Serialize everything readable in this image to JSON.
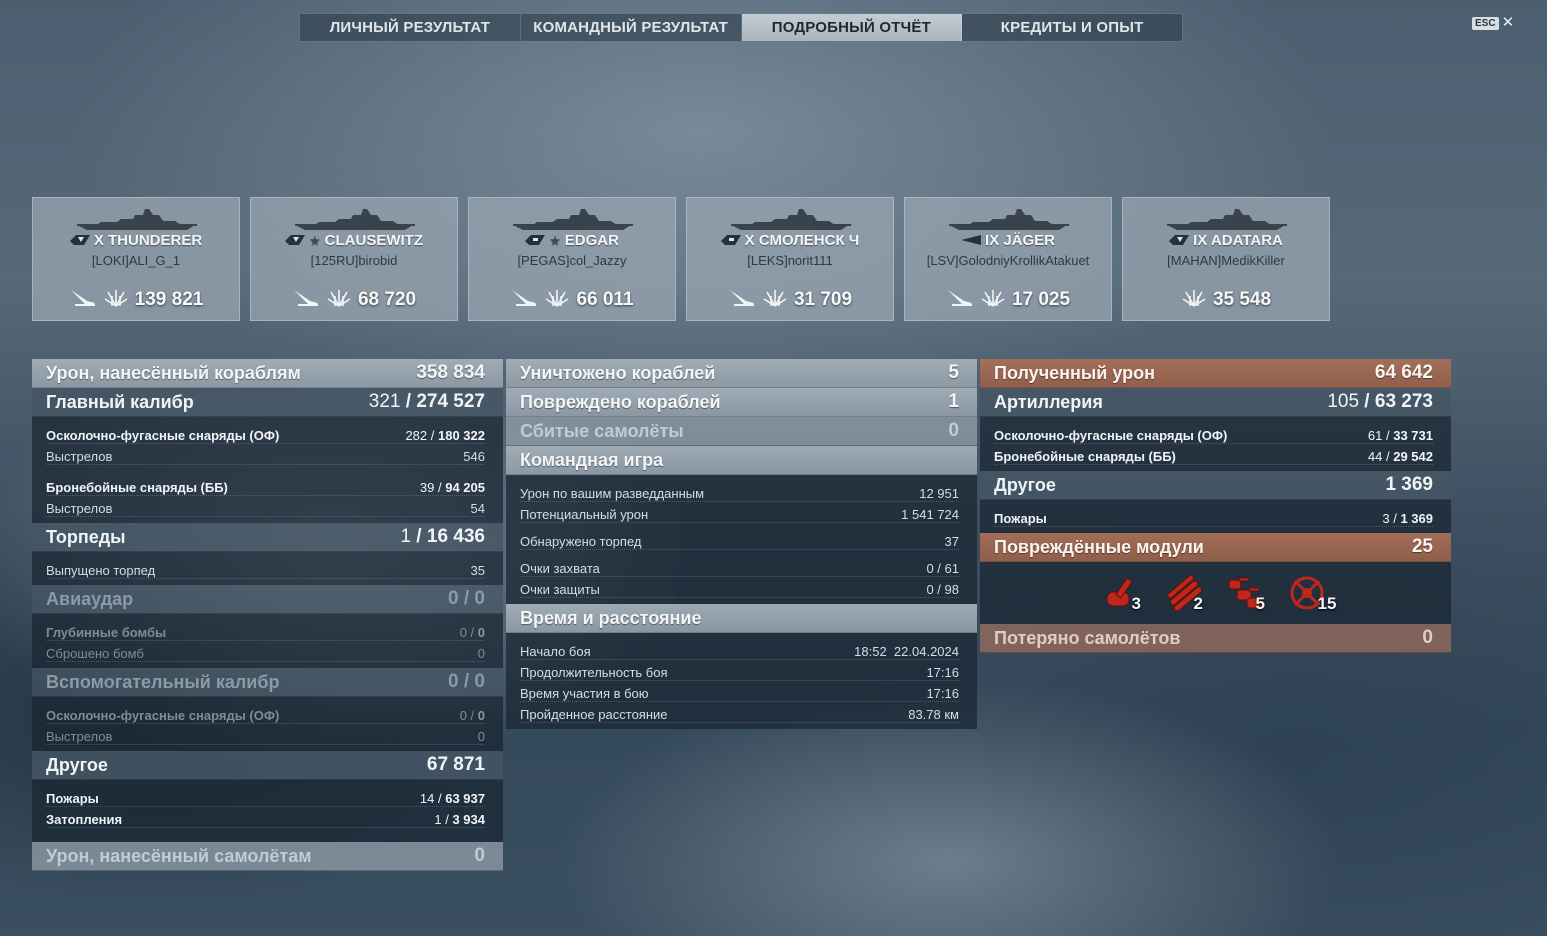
{
  "tabs": [
    "ЛИЧНЫЙ РЕЗУЛЬТАТ",
    "КОМАНДНЫЙ РЕЗУЛЬТАТ",
    "ПОДРОБНЫЙ ОТЧЁТ",
    "КРЕДИТЫ И ОПЫТ"
  ],
  "active_tab": "ПОДРОБНЫЙ ОТЧЁТ",
  "esc": {
    "key": "ESC",
    "close": "✕"
  },
  "ships": [
    {
      "name": "X THUNDERER",
      "player": "[LOKI]ALI_G_1",
      "damage": "139 821",
      "type_icon": "battleship-icon",
      "premium": false,
      "torpedo_icon": true
    },
    {
      "name": "CLAUSEWITZ",
      "player": "[125RU]birobid",
      "damage": "68 720",
      "type_icon": "battleship-icon",
      "premium": true,
      "torpedo_icon": true
    },
    {
      "name": "EDGAR",
      "player": "[PEGAS]col_Jazzy",
      "damage": "66 011",
      "type_icon": "cruiser-icon",
      "premium": true,
      "torpedo_icon": true
    },
    {
      "name": "X СМОЛЕНСК Ч",
      "player": "[LEKS]norit111",
      "damage": "31 709",
      "type_icon": "cruiser-icon",
      "premium": false,
      "torpedo_icon": true
    },
    {
      "name": "IX JÄGER",
      "player": "[LSV]GolodniyKrollikAtakuet",
      "damage": "17 025",
      "type_icon": "destroyer-icon",
      "premium": false,
      "torpedo_icon": true
    },
    {
      "name": "IX ADATARA",
      "player": "[MAHAN]MedikKiller",
      "damage": "35 548",
      "type_icon": "battleship-icon",
      "premium": false,
      "torpedo_icon": false
    }
  ],
  "left": {
    "total": {
      "label": "Урон, нанесённый кораблям",
      "value": "358 834"
    },
    "main": {
      "label": "Главный калибр",
      "hits": "321",
      "value": "274 527",
      "he_label": "Осколочно-фугасные снаряды (ОФ)",
      "he_hits": "282",
      "he_value": "180 322",
      "he_shots_label": "Выстрелов",
      "he_shots": "546",
      "ap_label": "Бронебойные снаряды (ББ)",
      "ap_hits": "39",
      "ap_value": "94 205",
      "ap_shots_label": "Выстрелов",
      "ap_shots": "54"
    },
    "torp": {
      "label": "Торпеды",
      "hits": "1",
      "value": "16 436",
      "launched_label": "Выпущено торпед",
      "launched": "35"
    },
    "air": {
      "label": "Авиаудар",
      "hits": "0",
      "value": "0",
      "dc_label": "Глубинные бомбы",
      "dc_hits": "0",
      "dc_value": "0",
      "bombs_label": "Сброшено бомб",
      "bombs": "0"
    },
    "sec": {
      "label": "Вспомогательный калибр",
      "hits": "0",
      "value": "0",
      "he_label": "Осколочно-фугасные снаряды (ОФ)",
      "he_hits": "0",
      "he_value": "0",
      "shots_label": "Выстрелов",
      "shots": "0"
    },
    "other": {
      "label": "Другое",
      "value": "67 871",
      "fires_label": "Пожары",
      "fires_count": "14",
      "fires_value": "63 937",
      "flood_label": "Затопления",
      "flood_count": "1",
      "flood_value": "3 934"
    },
    "planes": {
      "label": "Урон, нанесённый самолётам",
      "value": "0"
    }
  },
  "mid": {
    "destroyed": {
      "label": "Уничтожено кораблей",
      "value": "5"
    },
    "damaged": {
      "label": "Повреждено кораблей",
      "value": "1"
    },
    "planes": {
      "label": "Сбитые самолёты",
      "value": "0"
    },
    "team": {
      "label": "Командная игра",
      "spot_label": "Урон по вашим разведданным",
      "spot": "12 951",
      "pot_label": "Потенциальный урон",
      "pot": "1 541 724",
      "torp_label": "Обнаружено торпед",
      "torp": "37",
      "cap_label": "Очки захвата",
      "cap": "0 / 61",
      "def_label": "Очки защиты",
      "def": "0 / 98"
    },
    "time": {
      "label": "Время и расстояние",
      "start_label": "Начало боя",
      "start": "18:52  22.04.2024",
      "dur_label": "Продолжительность боя",
      "dur": "17:16",
      "part_label": "Время участия в бою",
      "part": "17:16",
      "dist_label": "Пройденное расстояние",
      "dist": "83.78 км"
    }
  },
  "right": {
    "received": {
      "label": "Полученный урон",
      "value": "64 642"
    },
    "art": {
      "label": "Артиллерия",
      "hits": "105",
      "value": "63 273",
      "he_label": "Осколочно-фугасные снаряды (ОФ)",
      "he_hits": "61",
      "he_value": "33 731",
      "ap_label": "Бронебойные снаряды (ББ)",
      "ap_hits": "44",
      "ap_value": "29 542"
    },
    "other": {
      "label": "Другое",
      "value": "1 369",
      "fires_label": "Пожары",
      "fires_count": "3",
      "fires_value": "1 369"
    },
    "modules": {
      "label": "Повреждённые модули",
      "value": "25",
      "items": [
        {
          "icon": "main-battery-module-icon",
          "count": "3"
        },
        {
          "icon": "torpedo-tubes-module-icon",
          "count": "2"
        },
        {
          "icon": "secondary-battery-module-icon",
          "count": "5"
        },
        {
          "icon": "aa-mount-module-icon",
          "count": "15"
        }
      ]
    },
    "planes_lost": {
      "label": "Потеряно самолётов",
      "value": "0"
    }
  }
}
